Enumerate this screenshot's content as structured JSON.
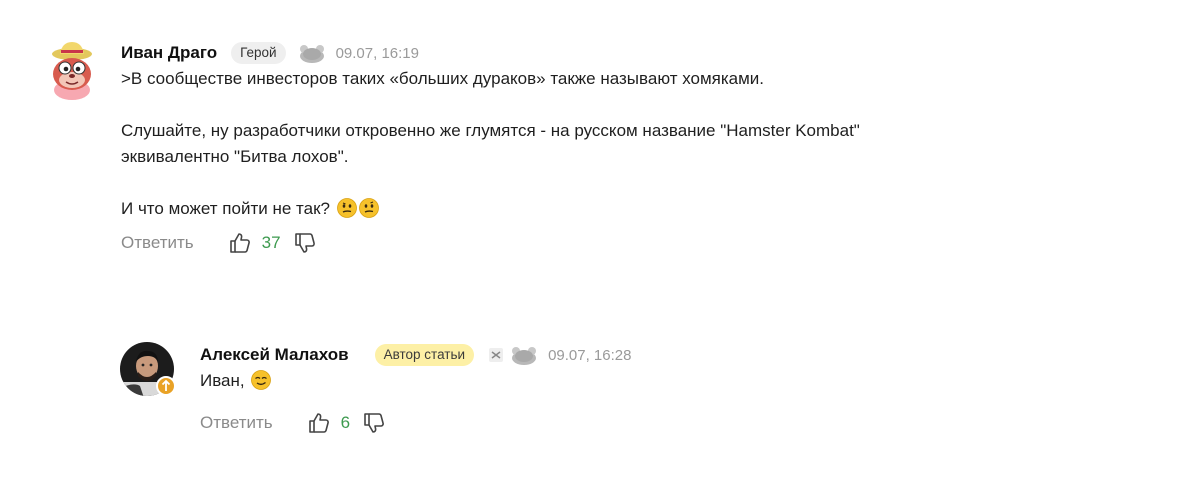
{
  "comments": [
    {
      "author": "Иван Драго",
      "badge": "Герой",
      "timestamp": "09.07, 16:19",
      "avatar_icon": "hamster-avatar-icon",
      "lines": [
        ">В сообществе инвесторов таких «больших дураков» также называют хомяками.",
        "Слушайте, ну разработчики откровенно же глумятся - на русском название \"Hamster Kombat\"",
        "эквивалентно \"Битва лохов\".",
        "И что может пойти не так?"
      ],
      "reply_label": "Ответить",
      "likes": "37"
    },
    {
      "author": "Алексей Малахов",
      "badge": "Автор статьи",
      "timestamp": "09.07, 16:28",
      "avatar_icon": "user-photo-avatar",
      "lines": [
        "Иван,"
      ],
      "reply_label": "Ответить",
      "likes": "6"
    }
  ],
  "colors": {
    "likes": "#3d9a4f",
    "author_badge": "#fdf0a6",
    "hero_badge": "#efefef",
    "muted": "#8a8a8a"
  }
}
